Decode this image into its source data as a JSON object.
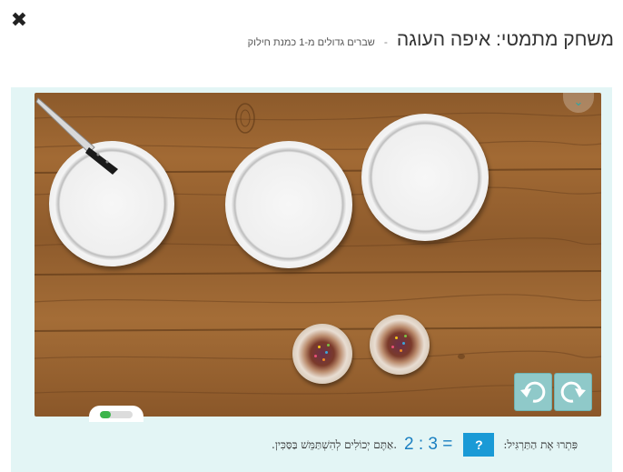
{
  "header": {
    "close_glyph": "✖",
    "title": "משחק מתמטי: איפה העוגה",
    "separator": "-",
    "subtitle": "שברים גדולים מ-1 כמנת חילוק"
  },
  "game": {
    "plates_count": 3,
    "cakes_count": 2,
    "progress_fraction": 0.33,
    "icons": {
      "toggle": "chevron-down-icon",
      "undo": "undo-icon",
      "redo": "redo-icon",
      "knife": "knife-icon"
    },
    "colors": {
      "accent": "#1a9ad6",
      "panel": "#e3f5f5",
      "control": "#8fc9c9",
      "progress": "#3cb44b"
    }
  },
  "footer": {
    "instruction": "פִּתְרוּ אֶת הַתַּרְגִּיל:",
    "answer_placeholder": "?",
    "equation": "2 : 3 =",
    "hint": ".אַתֶּם יְכוֹלִים לְהִשְׁתַּמֵּשׁ בַּסַּכִּין."
  }
}
